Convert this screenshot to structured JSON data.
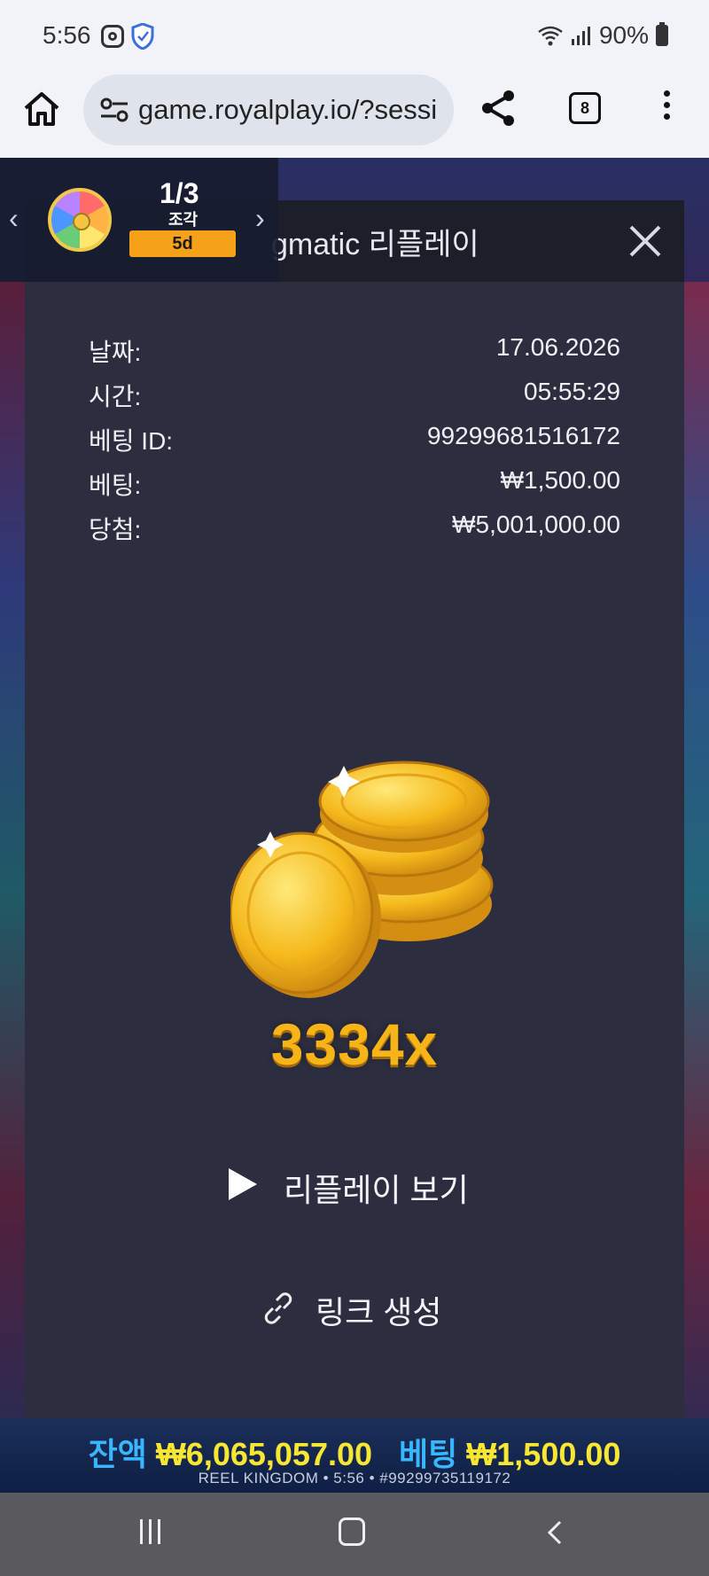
{
  "status_bar": {
    "time": "5:56",
    "battery": "90%",
    "icons": [
      "instagram-icon",
      "shield-icon",
      "wifi-icon",
      "signal-icon",
      "battery-icon"
    ]
  },
  "browser": {
    "url": "game.royalplay.io/?sessi",
    "tab_count": "8"
  },
  "reward_widget": {
    "progress": "1/3",
    "label": "조각",
    "days": "5d"
  },
  "replay": {
    "title": "gmatic 리플레이",
    "rows": [
      {
        "label": "날짜:",
        "value": "17.06.2026"
      },
      {
        "label": "시간:",
        "value": "05:55:29"
      },
      {
        "label": "베팅 ID:",
        "value": "99299681516172"
      },
      {
        "label": "베팅:",
        "value": "₩1,500.00"
      },
      {
        "label": "당첨:",
        "value": "₩5,001,000.00"
      }
    ],
    "multiplier": "3334x",
    "watch_replay": "리플레이 보기",
    "create_link": "링크 생성"
  },
  "game_footer": {
    "balance_label": "잔액",
    "balance_value": "₩6,065,057.00",
    "bet_label": "베팅",
    "bet_value": "₩1,500.00",
    "info_line": "REEL KINGDOM • 5:56 • #99299735119172"
  },
  "colors": {
    "panel": "#2c2e40",
    "accent_gold": "#f6b419",
    "balance_blue": "#38b6ff",
    "balance_yellow": "#f7e733",
    "badge_orange": "#f5a21a"
  }
}
